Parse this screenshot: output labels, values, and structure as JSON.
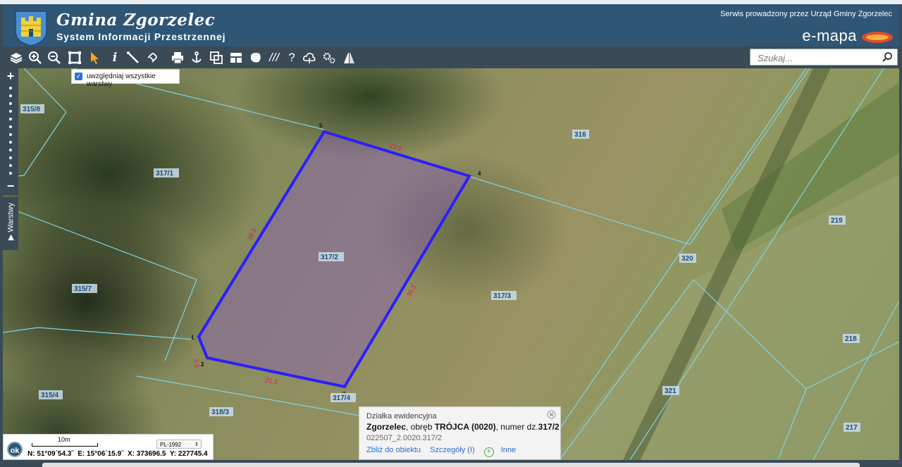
{
  "header": {
    "title": "Gmina Zgorzelec",
    "subtitle": "System Informacji Przestrzennej",
    "operator_note": "Serwis prowadzony przez Urząd Gminy Zgorzelec",
    "brand": "e-mapa"
  },
  "toolbar": {
    "icons": [
      "layers-icon",
      "zoom-in-icon",
      "zoom-out-icon",
      "zoom-extent-icon",
      "select-arrow-icon",
      "info-icon",
      "measure-line-icon",
      "link-icon",
      "print-icon",
      "anchor-icon",
      "copy-icon",
      "layout-icon",
      "area-icon",
      "hatch-icon",
      "help-icon",
      "cloud-icon",
      "settings-icon",
      "route-icon"
    ],
    "search_placeholder": "Szukaj..."
  },
  "layers_checkbox": {
    "label": "uwzględniaj wszystkie warstwy",
    "checked": true
  },
  "side_tab": {
    "label": "Warstwy"
  },
  "map": {
    "parcels": [
      {
        "id": "315/8"
      },
      {
        "id": "317/1"
      },
      {
        "id": "316"
      },
      {
        "id": "317/2"
      },
      {
        "id": "315/7"
      },
      {
        "id": "317/3"
      },
      {
        "id": "320"
      },
      {
        "id": "219"
      },
      {
        "id": "218"
      },
      {
        "id": "321"
      },
      {
        "id": "315/4"
      },
      {
        "id": "318/3"
      },
      {
        "id": "317/4"
      },
      {
        "id": "217"
      }
    ],
    "vertices": [
      "1",
      "2",
      "3",
      "4",
      "5"
    ],
    "dimensions": [
      "23.9",
      "38.3",
      "36.3",
      "21.3",
      "3.3"
    ]
  },
  "popup": {
    "heading": "Działka ewidencyjna",
    "place": "Zgorzelec",
    "obreb_text": ", obręb ",
    "obreb": "TRÓJCA (0020)",
    "numer_text": ", numer dz.",
    "numer": "317/2",
    "identifier": "022507_2.0020.317/2",
    "link_zoom": "Zbliż do obiektu",
    "link_details": "Szczegóły (I)",
    "link_other": "Inne"
  },
  "scale": {
    "label": "10m",
    "crs": "PL-1992",
    "ok": "ok"
  },
  "coords": {
    "lat": "N: 51°09´54.3˝",
    "lon": "E: 15°06´15.9˝",
    "x": "X: 373696.5",
    "y": "Y: 227745.4"
  },
  "colors": {
    "header": "#2f5675",
    "selection": "#2b1fff",
    "parcel_line": "#7fd3e6",
    "link": "#2a6fd1"
  }
}
